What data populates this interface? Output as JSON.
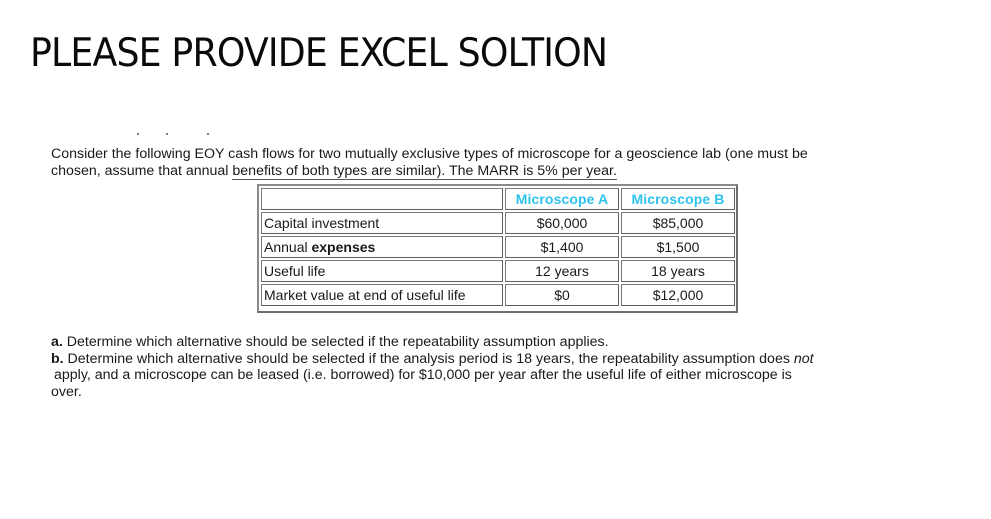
{
  "heading": "PLEASE PROVIDE EXCEL SOLTION",
  "intro": {
    "line1": "Consider the following EOY cash flows for two mutually exclusive types of microscope for a geoscience lab (one must be",
    "line2_before_underline": "chosen, assume that annual ",
    "line2_underlined": "benefits of both types are similar). The MARR is 5% per year."
  },
  "table": {
    "headers": [
      "",
      "Microscope A",
      "Microscope B"
    ],
    "header_color": "#2ec3ee",
    "rows": [
      {
        "label_plain": "Capital investment",
        "label_bold": "",
        "a": "$60,000",
        "b": "$85,000"
      },
      {
        "label_plain": "Annual ",
        "label_bold": "expenses",
        "a": "$1,400",
        "b": "$1,500"
      },
      {
        "label_plain": "Useful life",
        "label_bold": "",
        "a": "12 years",
        "b": "18 years"
      },
      {
        "label_plain": "Market value at end of useful life",
        "label_bold": "",
        "a": "$0",
        "b": "$12,000"
      }
    ]
  },
  "questions": {
    "a_marker": "a.",
    "a_text": " Determine which alternative should be selected if the repeatability assumption applies.",
    "b_marker": "b.",
    "b_text_1": " Determine which alternative should be selected if the analysis period is 18 years, the repeatability assumption does ",
    "b_text_italic": "not",
    "b_text_2": "apply, and a microscope can be leased (i.e. borrowed) for $10,000 per year after the useful life of either microscope is",
    "b_text_3": "over."
  }
}
